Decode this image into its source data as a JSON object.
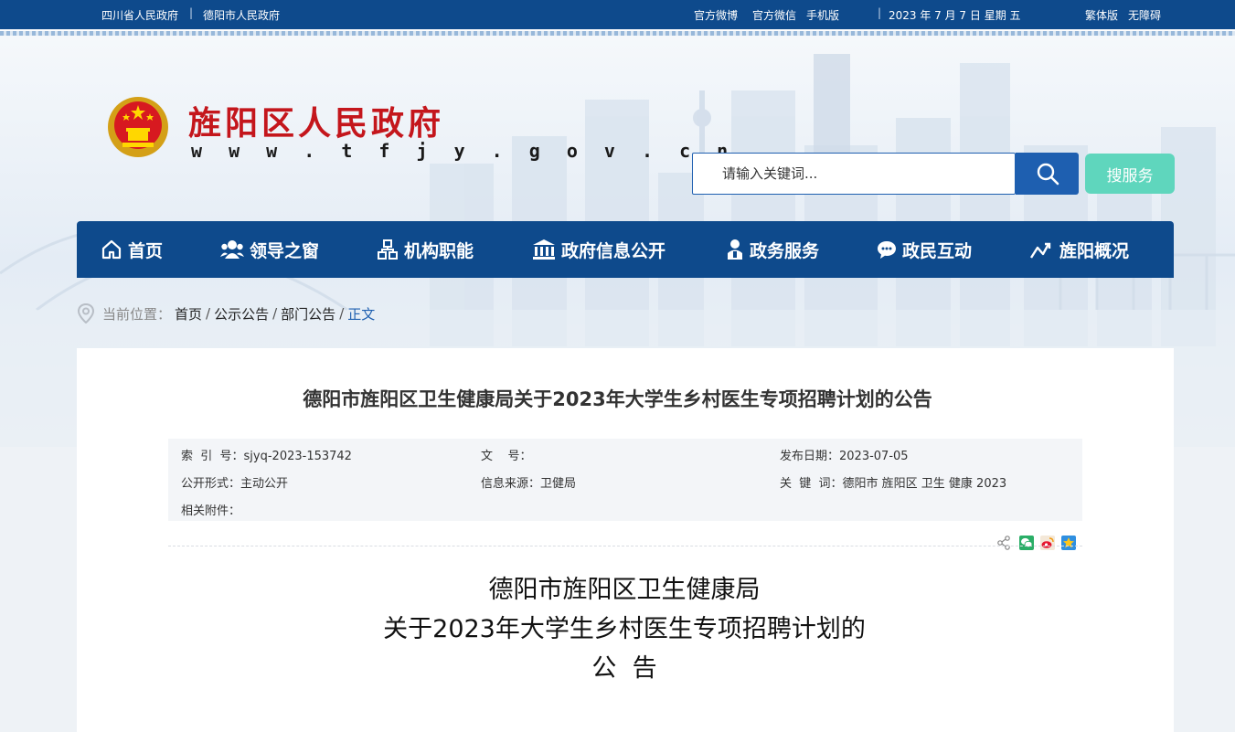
{
  "topbar": {
    "left_links": [
      "四川省人民政府",
      "德阳市人民政府"
    ],
    "separator": "|",
    "weibo": "官方微博",
    "wechat": "官方微信",
    "mobile": "手机版",
    "date": "2023 年 7 月 7 日 星期 五",
    "traditional": "繁体版",
    "accessible": "无障碍"
  },
  "header": {
    "site_title": "旌阳区人民政府",
    "site_url": "w w w . t f j y . g o v . c n"
  },
  "search": {
    "placeholder": "请输入关键词...",
    "service_label": "搜服务"
  },
  "nav": [
    {
      "label": "首页",
      "icon": "home-icon"
    },
    {
      "label": "领导之窗",
      "icon": "people-icon"
    },
    {
      "label": "机构职能",
      "icon": "org-chart-icon"
    },
    {
      "label": "政府信息公开",
      "icon": "government-building-icon"
    },
    {
      "label": "政务服务",
      "icon": "person-service-icon"
    },
    {
      "label": "政民互动",
      "icon": "chat-icon"
    },
    {
      "label": "旌阳概况",
      "icon": "trend-icon"
    }
  ],
  "breadcrumb": {
    "label": "当前位置：",
    "items": [
      "首页",
      "公示公告",
      "部门公告",
      "正文"
    ]
  },
  "article": {
    "title": "德阳市旌阳区卫生健康局关于2023年大学生乡村医生专项招聘计划的公告",
    "meta": {
      "index_label": "索  引  号：",
      "index_value": "sjyq-2023-153742",
      "doc_no_label": "文    号：",
      "doc_no_value": "",
      "publish_label": "发布日期：",
      "publish_value": "2023-07-05",
      "form_label": "公开形式：",
      "form_value": "主动公开",
      "source_label": "信息来源：",
      "source_value": "卫健局",
      "keywords_label": "关  键  词：",
      "keywords_value": "德阳市 旌阳区 卫生 健康 2023",
      "attachments_label": "相关附件："
    },
    "share_icons": [
      "share-icon",
      "wechat-icon",
      "weibo-icon",
      "qzone-icon"
    ],
    "body_title_lines": [
      "德阳市旌阳区卫生健康局",
      "关于2023年大学生乡村医生专项招聘计划的",
      "公  告"
    ]
  },
  "colors": {
    "primary": "#0e4a8c",
    "search_blue": "#1e5fb0",
    "service_green": "#5fd6bd",
    "title_red": "#c4161c"
  }
}
